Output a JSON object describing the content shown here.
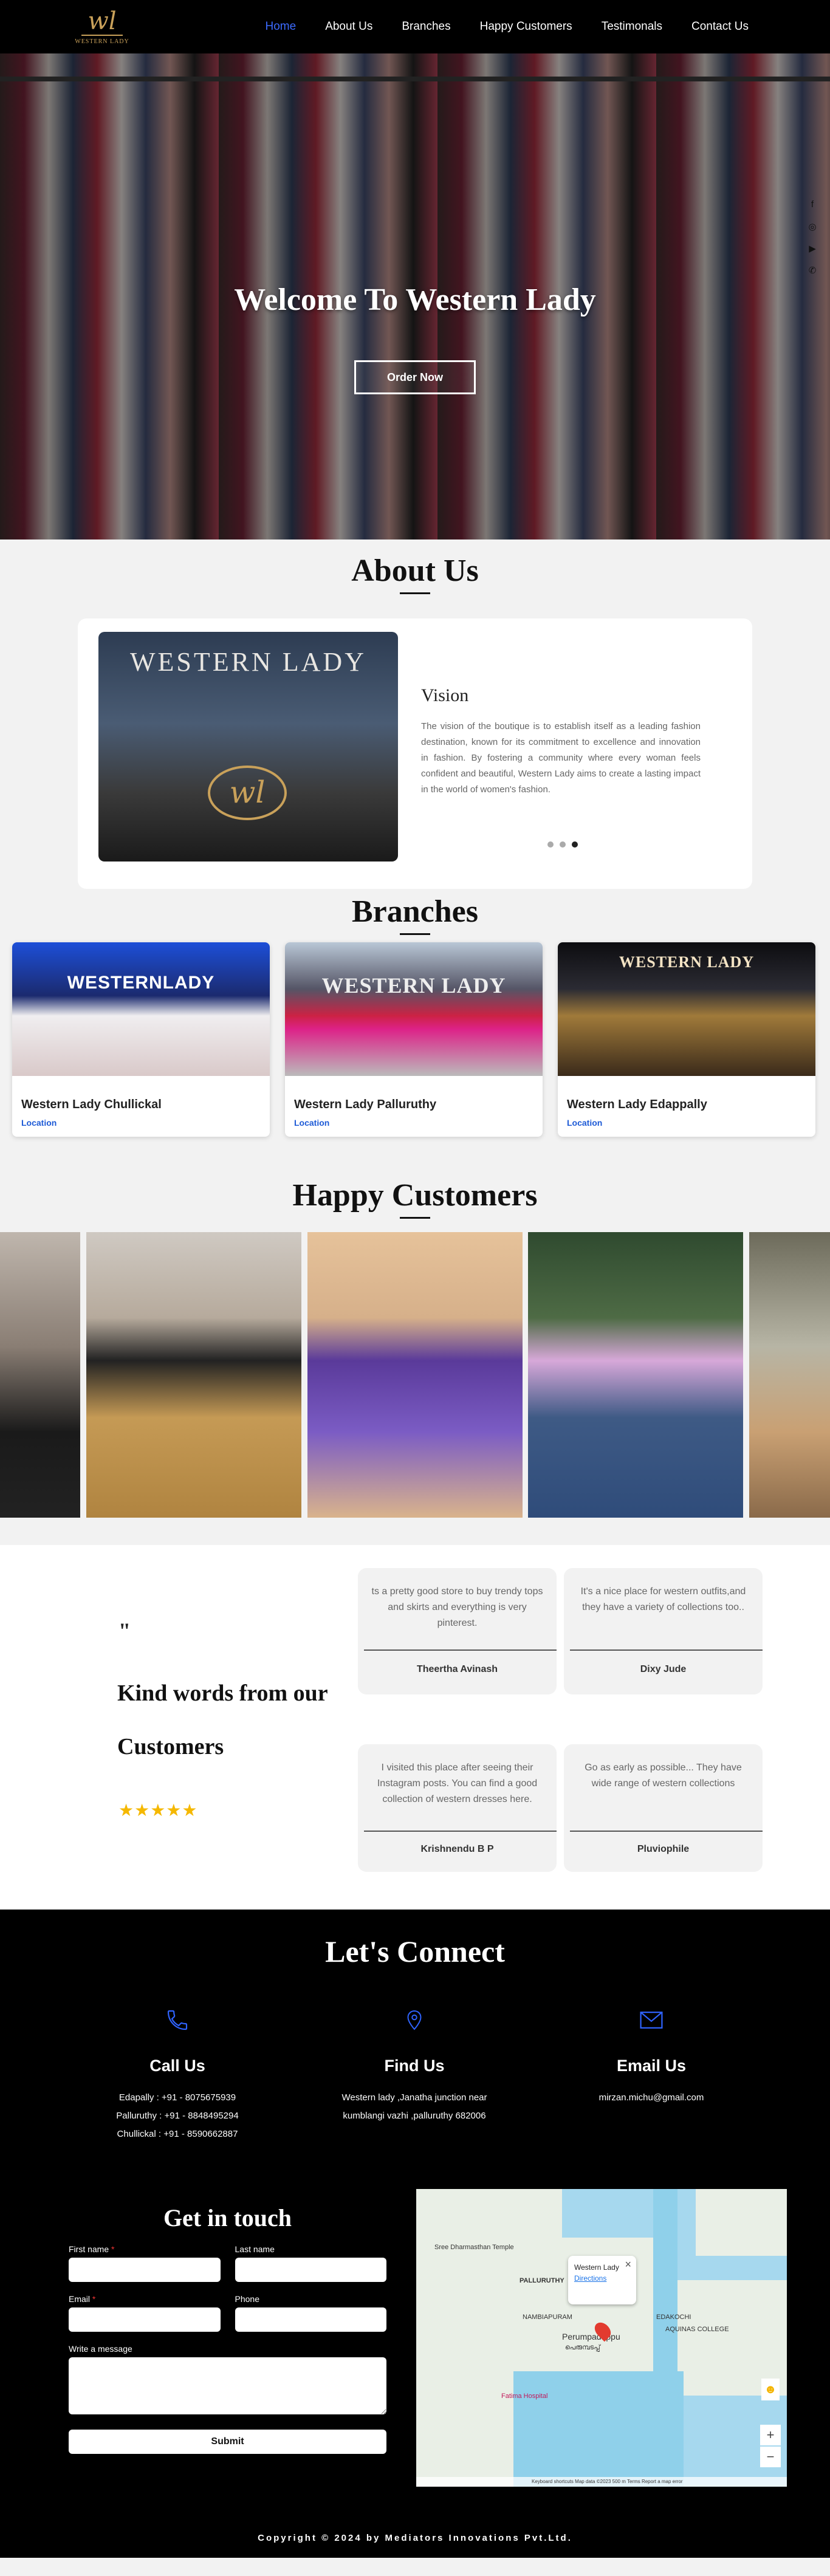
{
  "nav": {
    "logo_text": "WESTERN LADY",
    "logo_mark": "wl",
    "items": [
      {
        "label": "Home"
      },
      {
        "label": "About Us"
      },
      {
        "label": "Branches"
      },
      {
        "label": "Happy Customers"
      },
      {
        "label": "Testimonals"
      },
      {
        "label": "Contact Us"
      }
    ],
    "active_color": "#3c6bff"
  },
  "hero": {
    "title": "Welcome To Western Lady",
    "button": "Order Now",
    "social_icons": [
      "facebook-icon",
      "instagram-icon",
      "youtube-icon",
      "whatsapp-icon"
    ]
  },
  "about": {
    "title": "About Us",
    "image_sign": "WESTERN LADY",
    "image_emblem": "wl",
    "vision_title": "Vision",
    "vision_text": "The vision of the boutique is to establish itself as a leading fashion destination, known for its commitment to excellence and innovation in fashion. By fostering a community where every woman feels confident and beautiful, Western Lady aims to create a lasting impact in the world of women's fashion.",
    "slides": 3,
    "active_slide": 3
  },
  "branches": {
    "title": "Branches",
    "items": [
      {
        "sign": "WESTERNLADY",
        "name": "Western Lady Chullickal",
        "link": "Location"
      },
      {
        "sign": "WESTERN LADY",
        "name": "Western Lady Palluruthy",
        "link": "Location"
      },
      {
        "sign": "WESTERN LADY",
        "name": "Western Lady Edappally",
        "link": "Location"
      }
    ]
  },
  "customers": {
    "title": "Happy Customers",
    "photos": 5
  },
  "testimonials": {
    "quote_mark": "\"",
    "heading_line1": "Kind words from our",
    "heading_line2": "Customers",
    "stars": "★★★★★",
    "star_color": "#f5b800",
    "items": [
      {
        "text": "ts a pretty good store to buy trendy tops and skirts and everything is very pinterest.",
        "name": "Theertha Avinash"
      },
      {
        "text": "It's a nice place for western outfits,and they have a variety of collections too..",
        "name": "Dixy Jude"
      },
      {
        "text": "I visited this place after seeing their Instagram posts. You can find a good collection of western dresses here.",
        "name": "Krishnendu B P"
      },
      {
        "text": "Go as early as possible... They have wide range of western collections",
        "name": "Pluviophile"
      }
    ]
  },
  "connect": {
    "title": "Let's Connect",
    "icon_color": "#2f63ff",
    "columns": [
      {
        "icon": "phone-icon",
        "heading": "Call Us",
        "lines": [
          "Edapally : +91 - 8075675939",
          "Palluruthy : +91 - 8848495294",
          "Chullickal : +91 - 8590662887"
        ]
      },
      {
        "icon": "location-icon",
        "heading": "Find Us",
        "lines": [
          "Western lady ,Janatha junction near",
          "kumblangi vazhi ,palluruthy 682006"
        ]
      },
      {
        "icon": "mail-icon",
        "heading": "Email Us",
        "lines": [
          "mirzan.michu@gmail.com"
        ]
      }
    ],
    "form": {
      "title": "Get in touch",
      "first_name": "First name",
      "last_name": "Last name",
      "email": "Email",
      "phone": "Phone",
      "message": "Write a message",
      "submit": "Submit"
    },
    "map": {
      "popup_title": "Western Lady",
      "popup_link": "Directions",
      "labels": [
        "PALLURUTHY",
        "Perumpadappu",
        "പെരുമ്പടപ്പ്",
        "NAMBIAPURAM",
        "EDAKOCHI",
        "Fatima Hospital",
        "AQUINAS COLLEGE",
        "Sree Dharmasthan Temple"
      ],
      "footer": "Keyboard shortcuts   Map data ©2023   500 m   Terms   Report a map error",
      "zoom_in": "+",
      "zoom_out": "−"
    },
    "copyright": "Copyright © 2024 by Mediators Innovations Pvt.Ltd."
  }
}
